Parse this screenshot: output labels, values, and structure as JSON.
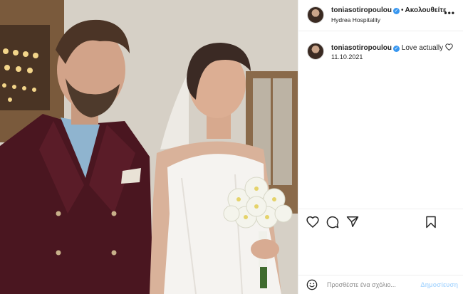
{
  "header": {
    "username": "toniasotiropoulou",
    "verified_mark": "✓",
    "separator": "•",
    "follow_label": "Ακολουθείτε",
    "location": "Hydrea Hospitality",
    "more_icon": "more-horizontal-icon"
  },
  "caption": {
    "username": "toniasotiropoulou",
    "verified_mark": "✓",
    "text": "Love actually",
    "date": "11.10.2021"
  },
  "actions": {
    "like_icon": "heart-icon",
    "comment_icon": "comment-icon",
    "share_icon": "send-icon",
    "save_icon": "bookmark-icon"
  },
  "comment_box": {
    "placeholder": "Προσθέστε ένα σχόλιο...",
    "post_label": "Δημοσίευση"
  },
  "colors": {
    "verified": "#3897f0",
    "post_disabled": "#b3dbff",
    "border": "#efefef"
  }
}
